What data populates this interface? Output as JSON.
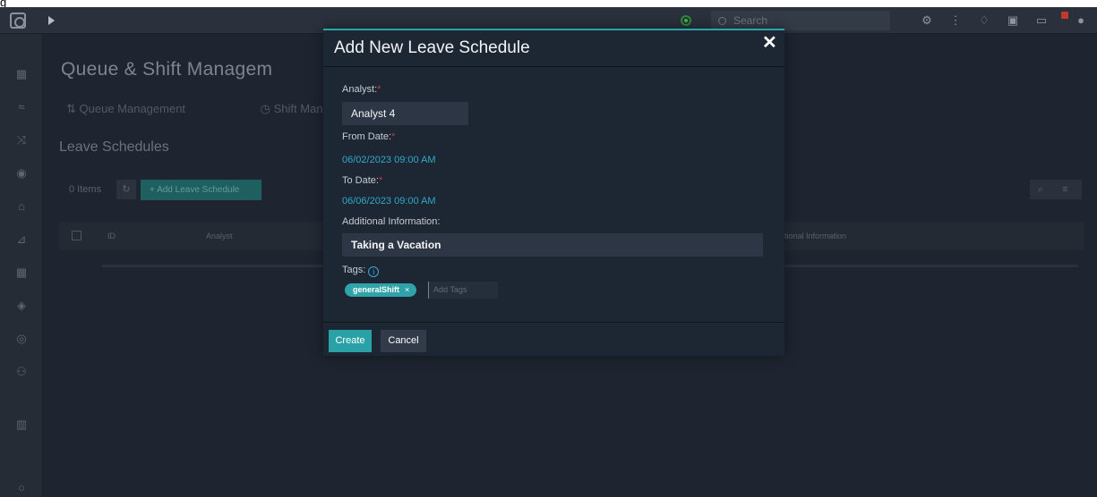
{
  "topbar": {
    "search_placeholder": "Search",
    "icons": [
      "settings-icon",
      "workflow-icon",
      "bell-icon",
      "clipboard-icon",
      "screen-alert-icon",
      "user-icon"
    ]
  },
  "sidebar": {
    "icons": [
      "dashboard-icon",
      "queue-icon",
      "shuffle-icon",
      "badge-icon",
      "building-icon",
      "chart-icon",
      "grid-icon",
      "shield-icon",
      "globe-icon",
      "team-icon",
      "trash-icon"
    ]
  },
  "page": {
    "title": "Queue & Shift Managem",
    "tabs": [
      "Queue Management",
      "Shift Mana"
    ],
    "section_title": "Leave Schedules",
    "items_count": "0 Items",
    "add_button": "+ Add Leave Schedule",
    "columns": [
      "ID",
      "Analyst",
      "itional Information"
    ]
  },
  "modal": {
    "title": "Add New Leave Schedule",
    "close_symbol": "✕",
    "analyst_label": "Analyst:",
    "analyst_value": "Analyst 4",
    "from_label": "From Date:",
    "from_value": "06/02/2023 09:00 AM",
    "to_label": "To Date:",
    "to_value": "06/06/2023 09:00 AM",
    "additional_label": "Additional Information:",
    "additional_value": "Taking a Vacation",
    "tags_label": "Tags:",
    "tags": [
      "generalShift"
    ],
    "tag_placeholder": "Add Tags",
    "create_label": "Create",
    "cancel_label": "Cancel",
    "required_mark": "*"
  },
  "colors": {
    "accent": "#2aa1a6",
    "date_text": "#31a8c8",
    "required": "#c0394b"
  }
}
